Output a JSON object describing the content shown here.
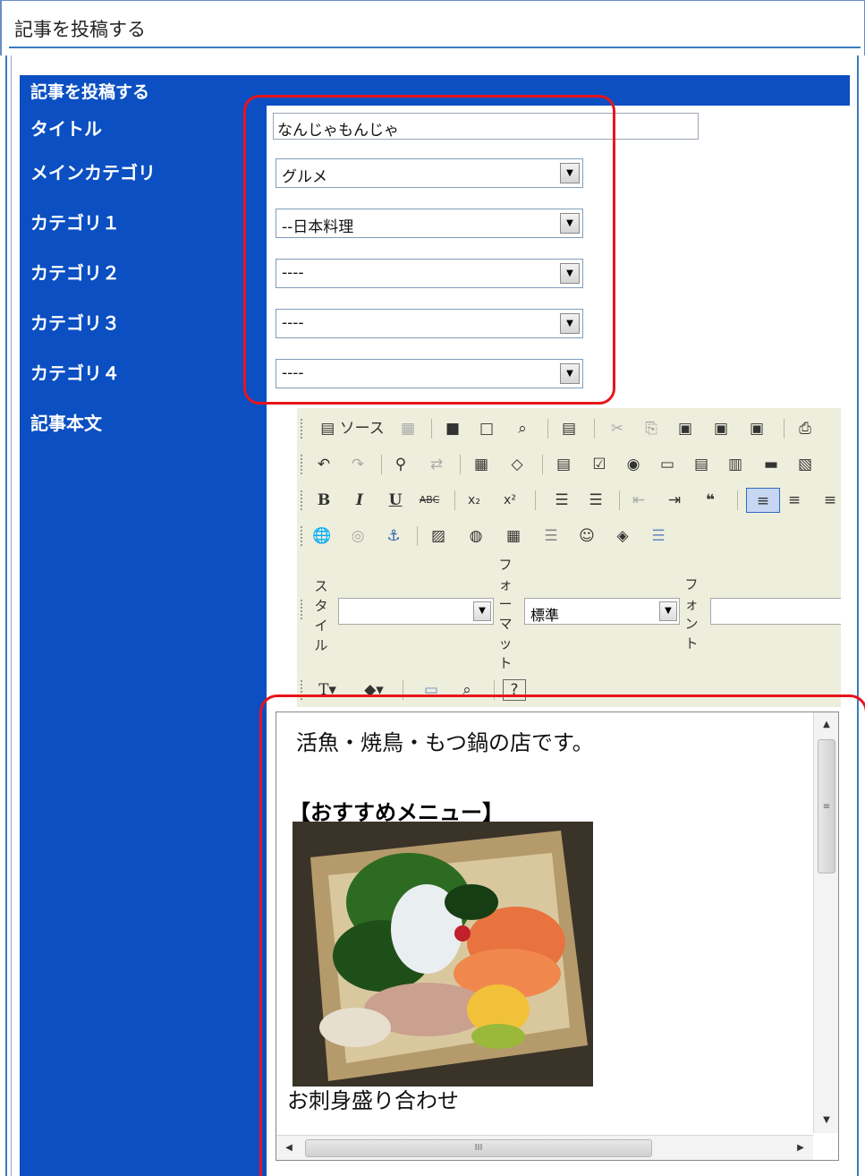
{
  "header": {
    "title": "記事を投稿する"
  },
  "form": {
    "panel_title": "記事を投稿する",
    "title_label": "タイトル",
    "title_value": "なんじゃもんじゃ",
    "main_category_label": "メインカテゴリ",
    "main_category_value": "グルメ",
    "category1_label": "カテゴリ１",
    "category1_value": "--日本料理",
    "category2_label": "カテゴリ２",
    "category2_value": "----",
    "category3_label": "カテゴリ３",
    "category3_value": "----",
    "category4_label": "カテゴリ４",
    "category4_value": "----",
    "body_label": "記事本文"
  },
  "editor": {
    "source_label": "ソース",
    "style_label": "スタイル",
    "style_value": "",
    "format_label": "フォーマット",
    "format_value": "標準",
    "font_label": "フォント",
    "font_value": "",
    "content": {
      "line1": "活魚・焼鳥・もつ鍋の店です。",
      "line2": "【おすすめメニュー】",
      "caption": "お刺身盛り合わせ"
    }
  },
  "icons": [
    "source-icon",
    "new-page-icon",
    "save-icon",
    "preview-icon",
    "template-icon",
    "cut-icon",
    "copy-icon",
    "paste-icon",
    "paste-text-icon",
    "paste-word-icon",
    "print-icon",
    "undo-icon",
    "redo-icon",
    "find-icon",
    "replace-icon",
    "select-all-icon",
    "eraser-icon",
    "form-icon",
    "checkbox-icon",
    "radio-icon",
    "textfield-icon",
    "textarea-icon",
    "select-icon",
    "button-icon",
    "image-button-icon",
    "bold-icon",
    "italic-icon",
    "underline-icon",
    "strike-icon",
    "subscript-icon",
    "superscript-icon",
    "ordered-list-icon",
    "unordered-list-icon",
    "outdent-icon",
    "indent-icon",
    "blockquote-icon",
    "align-left-icon",
    "align-center-icon",
    "align-right-icon",
    "link-icon",
    "unlink-icon",
    "anchor-icon",
    "image-icon",
    "flash-icon",
    "table-icon",
    "hr-icon",
    "smiley-icon",
    "special-char-icon",
    "page-break-icon",
    "text-color-icon",
    "bg-color-icon",
    "maximize-icon",
    "show-blocks-icon",
    "about-icon"
  ]
}
